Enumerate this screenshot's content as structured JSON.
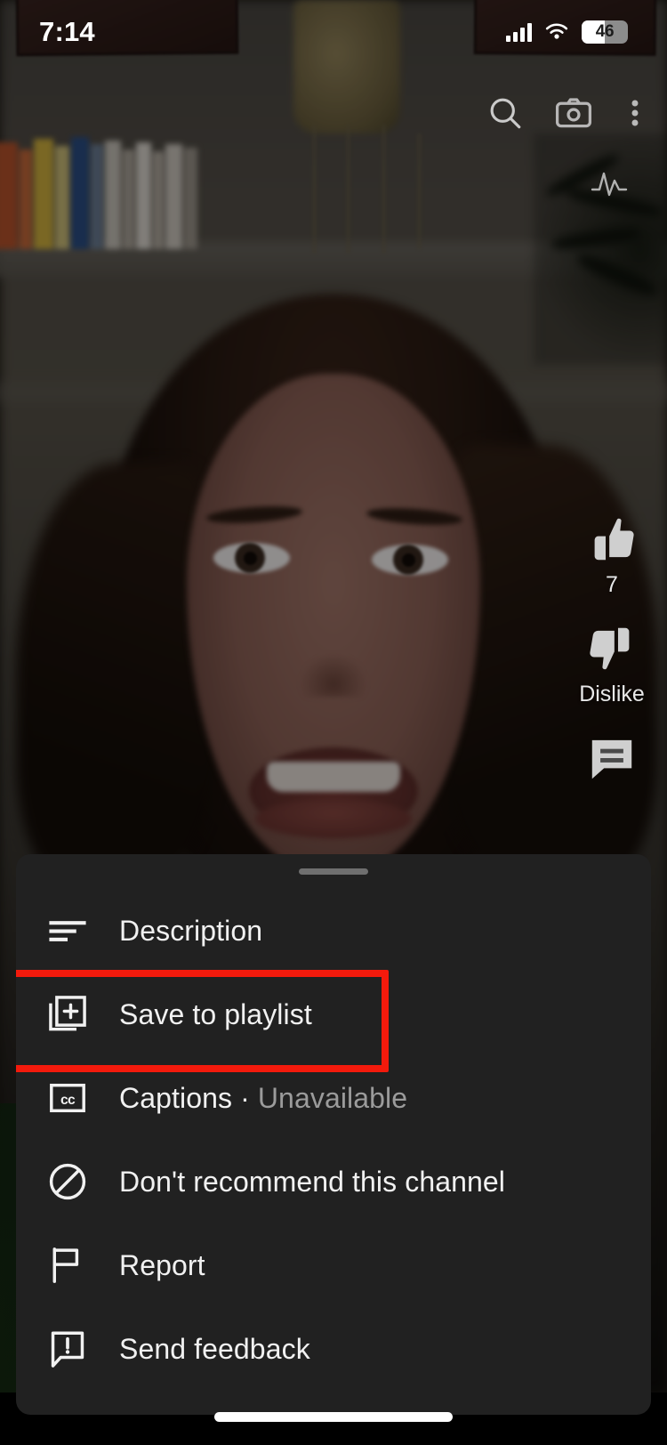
{
  "status_bar": {
    "time": "7:14",
    "battery_percent": "46",
    "icons": [
      "signal-bars-icon",
      "wifi-icon",
      "battery-icon"
    ]
  },
  "top_controls": {
    "search_icon": "search-icon",
    "camera_icon": "camera-icon",
    "more_icon": "more-vertical-icon",
    "pulse_icon": "pulse-waveform-icon"
  },
  "action_rail": {
    "like": {
      "icon": "thumbs-up-icon",
      "label": "7"
    },
    "dislike": {
      "icon": "thumbs-down-icon",
      "label": "Dislike"
    },
    "comments": {
      "icon": "comment-icon",
      "label": ""
    }
  },
  "sheet": {
    "handle": "drag-handle",
    "highlight_color": "#f31a0c",
    "background_color": "#212121",
    "items": [
      {
        "id": "description",
        "icon": "description-lines-icon",
        "label": "Description",
        "secondary": "",
        "highlighted": false
      },
      {
        "id": "save-playlist",
        "icon": "save-to-playlist-icon",
        "label": "Save to playlist",
        "secondary": "",
        "highlighted": true
      },
      {
        "id": "captions",
        "icon": "closed-captions-icon",
        "label": "Captions · ",
        "secondary": "Unavailable",
        "highlighted": false
      },
      {
        "id": "dont-recommend",
        "icon": "block-circle-icon",
        "label": "Don't recommend this channel",
        "secondary": "",
        "highlighted": false
      },
      {
        "id": "report",
        "icon": "flag-icon",
        "label": "Report",
        "secondary": "",
        "highlighted": false
      },
      {
        "id": "send-feedback",
        "icon": "feedback-exclaim-icon",
        "label": "Send feedback",
        "secondary": "",
        "highlighted": false
      }
    ]
  },
  "home_indicator": "home-indicator"
}
